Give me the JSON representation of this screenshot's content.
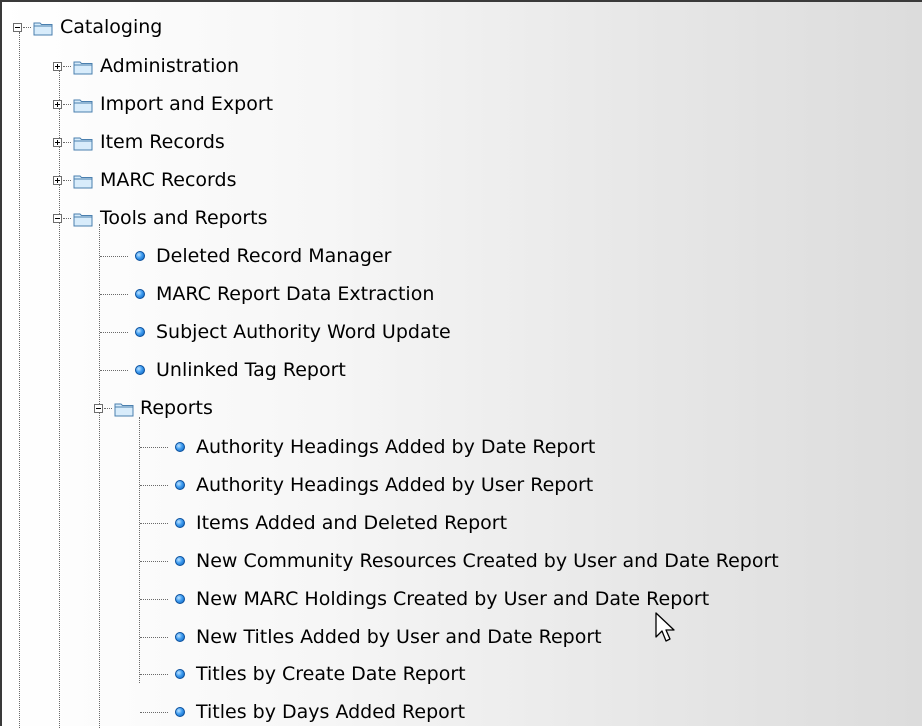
{
  "tree": {
    "root": {
      "label": "Cataloging",
      "expanded": true,
      "icon": "folder-icon"
    },
    "folders": [
      {
        "label": "Administration",
        "expanded": false,
        "icon": "folder-icon"
      },
      {
        "label": "Import and Export",
        "expanded": false,
        "icon": "folder-icon"
      },
      {
        "label": "Item Records",
        "expanded": false,
        "icon": "folder-icon"
      },
      {
        "label": "MARC Records",
        "expanded": false,
        "icon": "folder-icon"
      },
      {
        "label": "Tools and Reports",
        "expanded": true,
        "icon": "folder-icon"
      }
    ],
    "tools": [
      {
        "label": "Deleted Record Manager",
        "icon": "blue-bullet-icon"
      },
      {
        "label": "MARC Report Data Extraction",
        "icon": "blue-bullet-icon"
      },
      {
        "label": "Subject Authority Word Update",
        "icon": "blue-bullet-icon"
      },
      {
        "label": "Unlinked Tag Report",
        "icon": "blue-bullet-icon"
      }
    ],
    "reports_folder": {
      "label": "Reports",
      "expanded": true,
      "icon": "folder-icon"
    },
    "reports": [
      {
        "label": "Authority Headings Added by Date Report",
        "icon": "blue-bullet-icon"
      },
      {
        "label": "Authority Headings Added by User Report",
        "icon": "blue-bullet-icon"
      },
      {
        "label": "Items Added and Deleted Report",
        "icon": "blue-bullet-icon"
      },
      {
        "label": "New Community Resources Created by User and Date Report",
        "icon": "blue-bullet-icon"
      },
      {
        "label": "New MARC Holdings Created by User and Date Report",
        "icon": "blue-bullet-icon"
      },
      {
        "label": "New Titles Added by User and Date Report",
        "icon": "blue-bullet-icon"
      },
      {
        "label": "Titles by Create Date Report",
        "icon": "blue-bullet-icon"
      },
      {
        "label": "Titles by Days Added Report",
        "icon": "blue-bullet-icon"
      }
    ]
  },
  "colors": {
    "folder_fill": "#d8ecfb",
    "folder_stroke": "#4a7fae",
    "bullet": "#3e9cf0",
    "tree_line": "#6a6a6a"
  }
}
